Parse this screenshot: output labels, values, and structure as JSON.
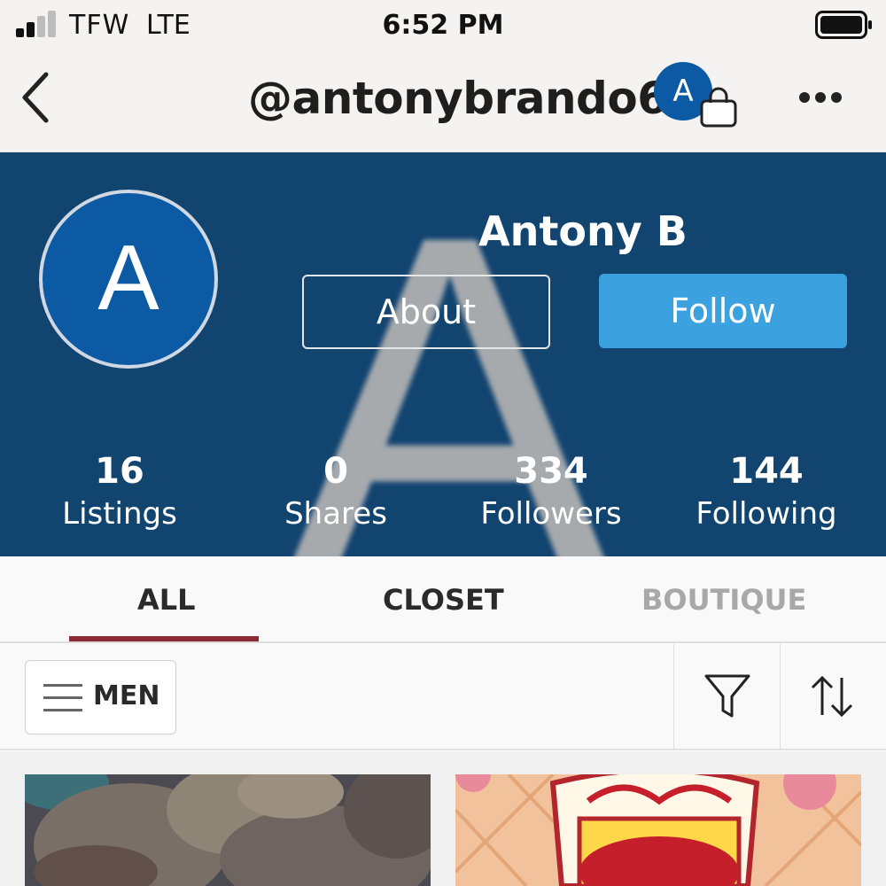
{
  "status_bar": {
    "carrier": "TFW",
    "network": "LTE",
    "time": "6:52 PM"
  },
  "header": {
    "username": "@antonybrando67",
    "avatar_letter": "A"
  },
  "profile": {
    "avatar_letter": "A",
    "watermark_letter": "A",
    "display_name": "Antony B",
    "about_label": "About",
    "follow_label": "Follow",
    "stats": [
      {
        "value": "16",
        "label": "Listings"
      },
      {
        "value": "0",
        "label": "Shares"
      },
      {
        "value": "334",
        "label": "Followers"
      },
      {
        "value": "144",
        "label": "Following"
      }
    ]
  },
  "tabs": [
    {
      "label": "ALL",
      "active": true
    },
    {
      "label": "CLOSET",
      "active": false
    },
    {
      "label": "BOUTIQUE",
      "active": false,
      "disabled": true
    }
  ],
  "filter_bar": {
    "department_label": "MEN"
  },
  "icons": {
    "back": "chevron-left-icon",
    "bag": "shopping-bag-icon",
    "more": "more-horizontal-icon",
    "menu": "hamburger-menu-icon",
    "filter": "funnel-icon",
    "sort": "sort-arrows-icon"
  },
  "colors": {
    "cover_bg": "#124470",
    "avatar_bg": "#0b5aa3",
    "follow_button": "#3ba1df",
    "tab_underline": "#8b2a34",
    "tab_disabled": "#a8a8a8"
  }
}
